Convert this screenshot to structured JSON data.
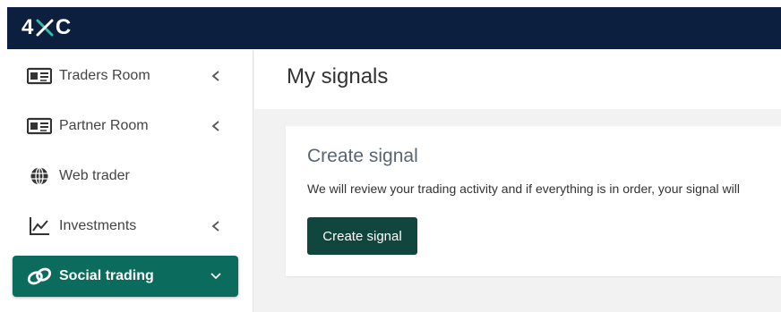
{
  "brand": {
    "logo_text_left": "4",
    "logo_text_right": "C"
  },
  "sidebar": {
    "items": [
      {
        "label": "Traders Room",
        "icon": "id-card-icon",
        "expand_icon": "chevron-left-icon",
        "active": false
      },
      {
        "label": "Partner Room",
        "icon": "id-card-icon",
        "expand_icon": "chevron-left-icon",
        "active": false
      },
      {
        "label": "Web trader",
        "icon": "globe-icon",
        "active": false
      },
      {
        "label": "Investments",
        "icon": "line-chart-icon",
        "expand_icon": "chevron-left-icon",
        "active": false
      },
      {
        "label": "Social trading",
        "icon": "link-icon",
        "expand_icon": "chevron-down-icon",
        "active": true
      }
    ]
  },
  "main": {
    "title": "My signals",
    "card": {
      "title": "Create signal",
      "description": "We will review your trading activity and if everything is in order, your signal will",
      "button_label": "Create signal"
    }
  },
  "colors": {
    "topbar": "#0c1f3f",
    "active_item": "#0b6b5c",
    "button": "#11463e",
    "logo_accent": "#2fbfa5"
  }
}
